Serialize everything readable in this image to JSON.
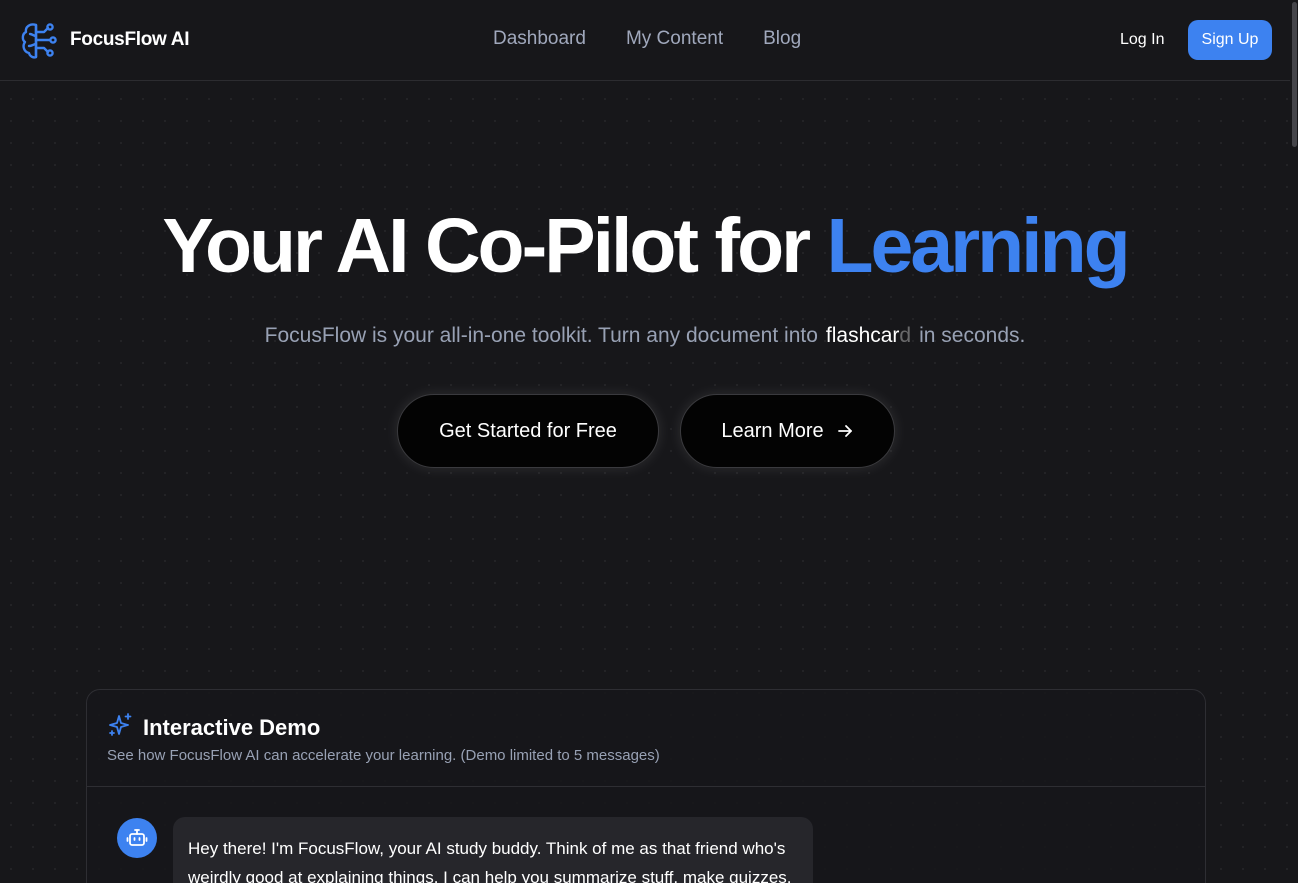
{
  "brand": {
    "name": "FocusFlow AI",
    "logo_icon": "brain-circuit-icon",
    "accent_color": "#3d82f0"
  },
  "nav": {
    "links": [
      "Dashboard",
      "My Content",
      "Blog"
    ],
    "login_label": "Log In",
    "signup_label": "Sign Up"
  },
  "hero": {
    "title_main": "Your AI Co-Pilot for",
    "title_accent": "Learning",
    "subtitle_before": "FocusFlow is your all-in-one toolkit. Turn any document into",
    "typed_word": "flashcar",
    "typed_fade": "d",
    "subtitle_after": "in seconds.",
    "primary_button": "Get Started for Free",
    "secondary_button": "Learn More",
    "secondary_icon": "arrow-right-icon"
  },
  "demo": {
    "icon": "sparkles-icon",
    "title": "Interactive Demo",
    "description": "See how FocusFlow AI can accelerate your learning. (Demo limited to 5 messages)",
    "bot_icon": "bot-icon",
    "first_message": "Hey there! I'm FocusFlow, your AI study buddy. Think of me as that friend who's weirdly good at explaining things. I can help you summarize stuff, make quizzes,"
  }
}
